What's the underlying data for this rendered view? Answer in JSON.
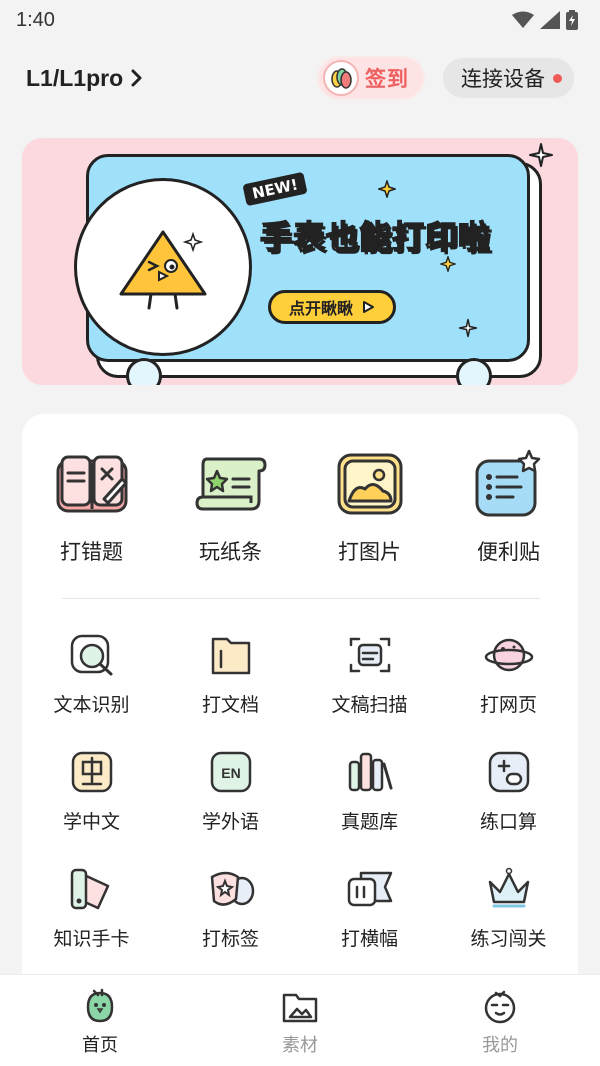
{
  "status_bar": {
    "time": "1:40"
  },
  "header": {
    "device_title": "L1/L1pro",
    "checkin_label": "签到",
    "connect_label": "连接设备"
  },
  "banner": {
    "badge": "NEW!",
    "headline": "手表也能打印啦",
    "cta": "点开瞅瞅"
  },
  "primary_features": [
    {
      "label": "打错题",
      "icon": "wrong-question-book-icon"
    },
    {
      "label": "玩纸条",
      "icon": "paper-scroll-icon"
    },
    {
      "label": "打图片",
      "icon": "picture-icon"
    },
    {
      "label": "便利贴",
      "icon": "sticky-note-icon"
    }
  ],
  "tools": [
    {
      "label": "文本识别",
      "icon": "text-recognition-icon"
    },
    {
      "label": "打文档",
      "icon": "document-folder-icon"
    },
    {
      "label": "文稿扫描",
      "icon": "scan-document-icon"
    },
    {
      "label": "打网页",
      "icon": "planet-web-icon"
    },
    {
      "label": "学中文",
      "icon": "chinese-character-icon"
    },
    {
      "label": "学外语",
      "icon": "english-en-icon"
    },
    {
      "label": "真题库",
      "icon": "books-library-icon"
    },
    {
      "label": "练口算",
      "icon": "calculator-icon"
    },
    {
      "label": "知识手卡",
      "icon": "flash-cards-icon"
    },
    {
      "label": "打标签",
      "icon": "label-tag-icon"
    },
    {
      "label": "打横幅",
      "icon": "banner-ticket-icon"
    },
    {
      "label": "练习闯关",
      "icon": "crown-challenge-icon"
    }
  ],
  "bottom_nav": [
    {
      "label": "首页",
      "icon": "home-bird-icon",
      "active": true
    },
    {
      "label": "素材",
      "icon": "materials-image-icon",
      "active": false
    },
    {
      "label": "我的",
      "icon": "profile-bird-icon",
      "active": false
    }
  ],
  "colors": {
    "accent_red": "#ef6161",
    "banner_pink": "#fcd9de",
    "banner_blue": "#9fe0fb",
    "icon_outline": "#333333"
  }
}
